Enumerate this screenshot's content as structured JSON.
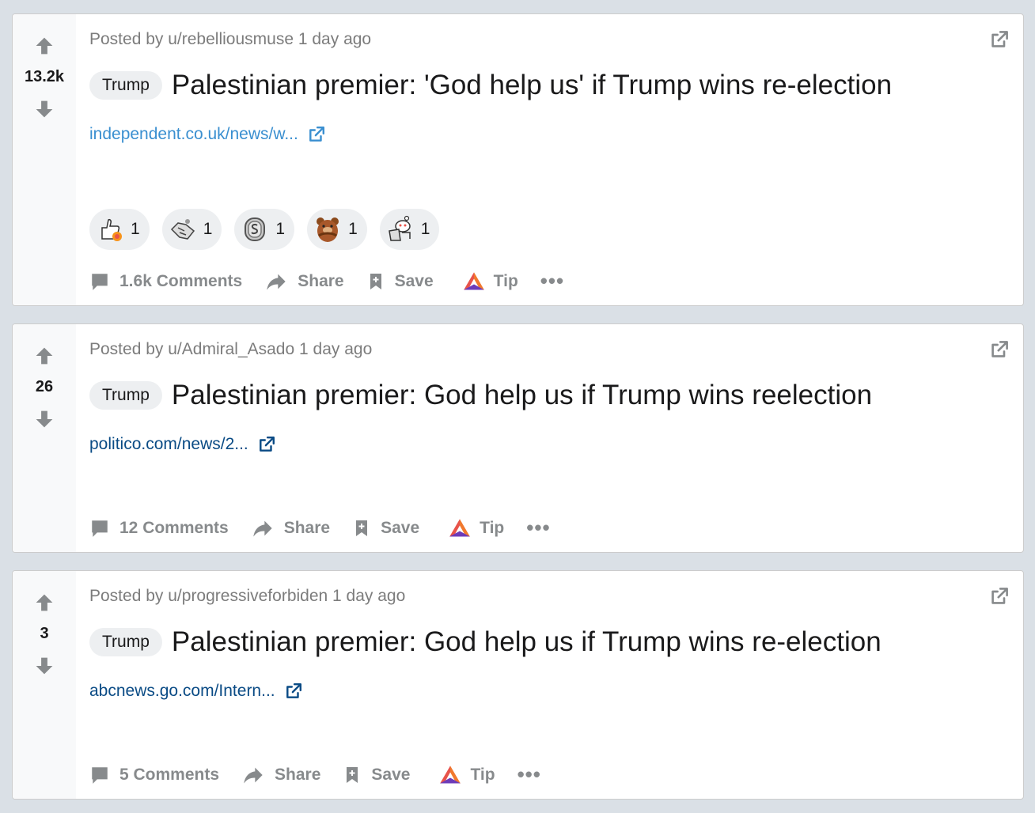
{
  "colors": {
    "background": "#dae0e6",
    "card": "#ffffff",
    "vote_column": "#f8f9fa",
    "muted_text": "#7c7c7c",
    "action_text": "#878a8c",
    "link_blue": "#3a8fd0",
    "link_dark": "#0a4b85",
    "flair_bg": "#edeff1"
  },
  "posts": [
    {
      "score": "13.2k",
      "posted_by_prefix": "Posted by",
      "author": "u/rebelliousmuse",
      "time": "1 day ago",
      "flair": "Trump",
      "title": "Palestinian premier: 'God help us' if Trump wins re-election",
      "link": "independent.co.uk/news/w...",
      "awards": [
        {
          "icon": "thumbs-up-rocket-icon",
          "count": "1"
        },
        {
          "icon": "handshake-icon",
          "count": "1"
        },
        {
          "icon": "silver-coin-icon",
          "count": "1"
        },
        {
          "icon": "bear-hug-icon",
          "count": "1"
        },
        {
          "icon": "snoo-laptop-icon",
          "count": "1"
        }
      ],
      "comments": "1.6k Comments",
      "share": "Share",
      "save": "Save",
      "tip": "Tip",
      "more": "•••"
    },
    {
      "score": "26",
      "posted_by_prefix": "Posted by",
      "author": "u/Admiral_Asado",
      "time": "1 day ago",
      "flair": "Trump",
      "title": "Palestinian premier: God help us if Trump wins reelection",
      "link": "politico.com/news/2...",
      "comments": "12 Comments",
      "share": "Share",
      "save": "Save",
      "tip": "Tip",
      "more": "•••"
    },
    {
      "score": "3",
      "posted_by_prefix": "Posted by",
      "author": "u/progressiveforbiden",
      "time": "1 day ago",
      "flair": "Trump",
      "title": "Palestinian premier: God help us if Trump wins re-election",
      "link": "abcnews.go.com/Intern...",
      "comments": "5 Comments",
      "share": "Share",
      "save": "Save",
      "tip": "Tip",
      "more": "•••"
    }
  ]
}
